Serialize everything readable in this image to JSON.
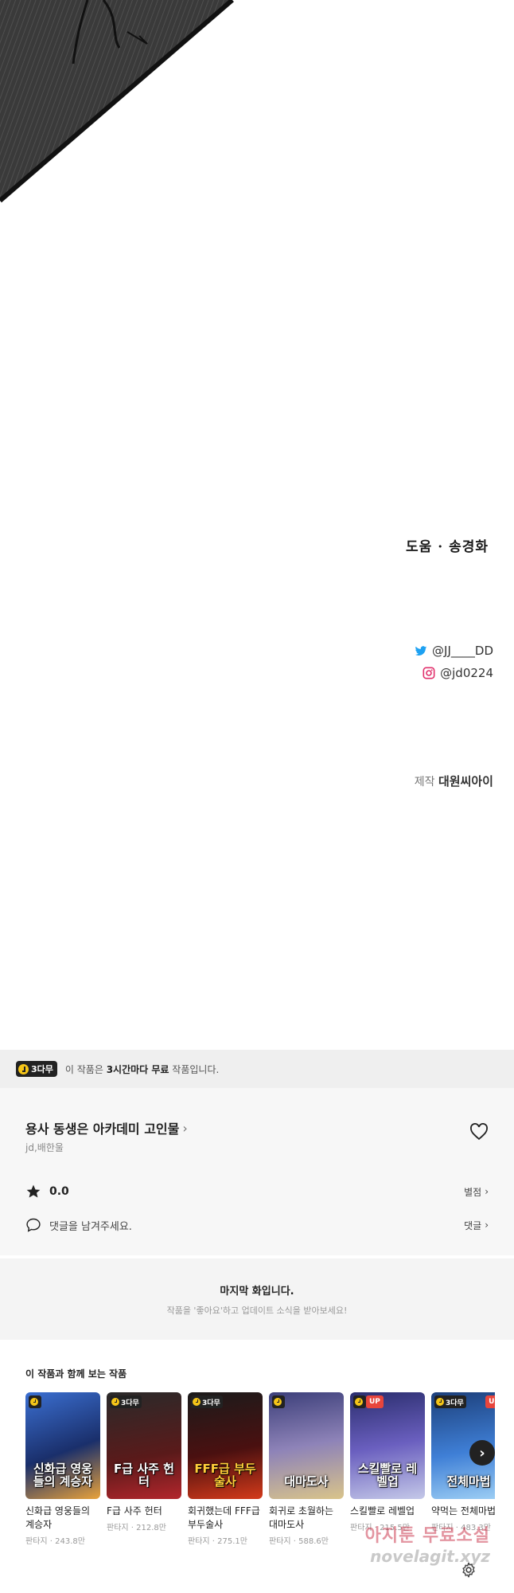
{
  "credits": {
    "assist": "도움 · 송경화",
    "twitter": "@JJ____DD",
    "instagram": "@jd0224",
    "production_label": "제작",
    "production_name": "대원씨아이"
  },
  "free_notice": {
    "badge": "3다무",
    "prefix": "이 작품은 ",
    "highlight": "3시간마다 무료",
    "suffix": " 작품입니다."
  },
  "work": {
    "title": "용사 동생은 아카데미 고인물",
    "author": "jd,배한울",
    "rating": "0.0",
    "rating_link": "별점",
    "comment_placeholder": "댓글을 남겨주세요.",
    "comment_link": "댓글"
  },
  "last_episode": {
    "title": "마지막 화입니다.",
    "subtitle": "작품을 '좋아요'하고 업데이트 소식을 받아보세요!"
  },
  "recommendations": {
    "heading": "이 작품과 함께 보는 작품",
    "items": [
      {
        "thumb_text": "신화급 영웅들의 계승자",
        "name": "신화급 영웅들의 계승자",
        "meta": "판타지 · 243.8만",
        "badge": "",
        "up": ""
      },
      {
        "thumb_text": "F급 사주 헌터",
        "name": "F급 사주 헌터",
        "meta": "판타지 · 212.8만",
        "badge": "3다무",
        "up": ""
      },
      {
        "thumb_text": "FFF급 부두술사",
        "name": "회귀했는데 FFF급 부두술사",
        "meta": "판타지 · 275.1만",
        "badge": "3다무",
        "up": ""
      },
      {
        "thumb_text": "대마도사",
        "name": "회귀로 초월하는 대마도사",
        "meta": "판타지 · 588.6만",
        "badge": "",
        "up": ""
      },
      {
        "thumb_text": "스킬빨로 레벨업",
        "name": "스킬빨로 레벨업",
        "meta": "판타지 · 215.5만",
        "badge": "",
        "up": "UP"
      },
      {
        "thumb_text": "전체마법",
        "name": "약먹는 전체마법사",
        "meta": "판타지 · 483.3만",
        "badge": "3다무",
        "up": "UP"
      }
    ]
  },
  "watermark": {
    "line1": "아지툰 무료소설",
    "line2": "novelagit.xyz"
  },
  "icons": {
    "twitter": "twitter-icon",
    "instagram": "instagram-icon",
    "heart": "heart-icon",
    "star": "star-icon",
    "comment": "comment-icon",
    "next": "chevron-right-icon",
    "settings": "gear-icon"
  },
  "colors": {
    "badge_clock": "#f5c518",
    "up_badge": "#e8453c",
    "twitter_blue": "#1da1f2"
  }
}
